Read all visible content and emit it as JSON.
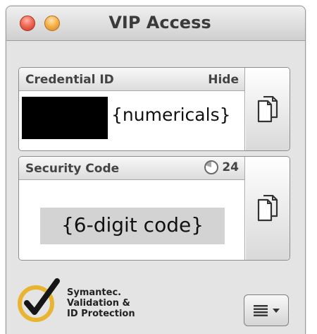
{
  "window": {
    "title": "VIP Access"
  },
  "credential": {
    "label": "Credential ID",
    "hide_label": "Hide",
    "value": "{numericals}"
  },
  "security": {
    "label": "Security Code",
    "seconds_remaining": "24",
    "code": "{6-digit code}"
  },
  "branding": {
    "line1": "Symantec.",
    "line2": "Validation &",
    "line3": "ID Protection"
  },
  "icons": {
    "close": "close-button-icon",
    "minimize": "minimize-button-icon",
    "timer": "timer-icon",
    "copy": "copy-icon",
    "menu": "menu-icon",
    "dropdown": "chevron-down-icon",
    "logo": "checkmark-logo"
  },
  "colors": {
    "close": "#e0523d",
    "minimize": "#f2a93b",
    "logo_ring": "#e9b531",
    "redaction": "#000000",
    "code_highlight": "#d3d3d3"
  }
}
